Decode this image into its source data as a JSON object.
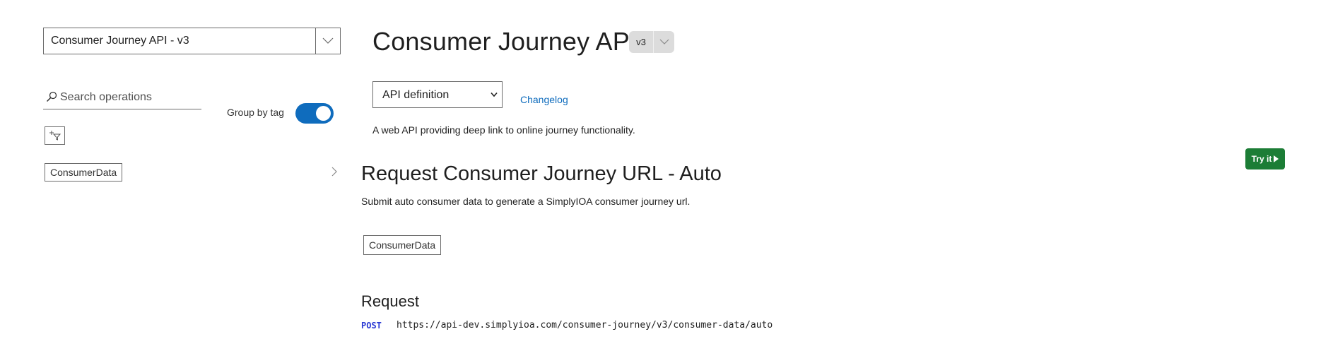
{
  "sidebar": {
    "api_selector": {
      "value": "Consumer Journey API - v3",
      "icon": "chevron-down-icon"
    },
    "search": {
      "placeholder": "Search operations",
      "value": "",
      "icon": "search-icon"
    },
    "group_by_tag": {
      "label": "Group by tag",
      "on": true
    },
    "filter_button": {
      "icon": "add-filter-icon"
    },
    "tags": [
      {
        "label": "ConsumerData",
        "icon": "chevron-right-icon"
      }
    ]
  },
  "main": {
    "title": "Consumer Journey API",
    "version_badge": {
      "label": "v3",
      "icon": "chevron-down-icon"
    },
    "definition_select": {
      "value": "API definition",
      "options": [
        "API definition"
      ]
    },
    "changelog_link": "Changelog",
    "description": "A web API providing deep link to online journey functionality.",
    "try_it_button": {
      "label": "Try it",
      "icon": "play-icon"
    },
    "operation": {
      "title": "Request Consumer Journey URL - Auto",
      "description": "Submit auto consumer data to generate a SimplyIOA consumer journey url.",
      "tag": "ConsumerData",
      "request_heading": "Request",
      "method": "POST",
      "url": "https://api-dev.simplyioa.com/consumer-journey/v3/consumer-data/auto"
    }
  },
  "colors": {
    "accent": "#0f6cbd",
    "try_it": "#1c7d36",
    "method_post": "#2b3ad4",
    "badge_bg": "#dcdcdc"
  }
}
